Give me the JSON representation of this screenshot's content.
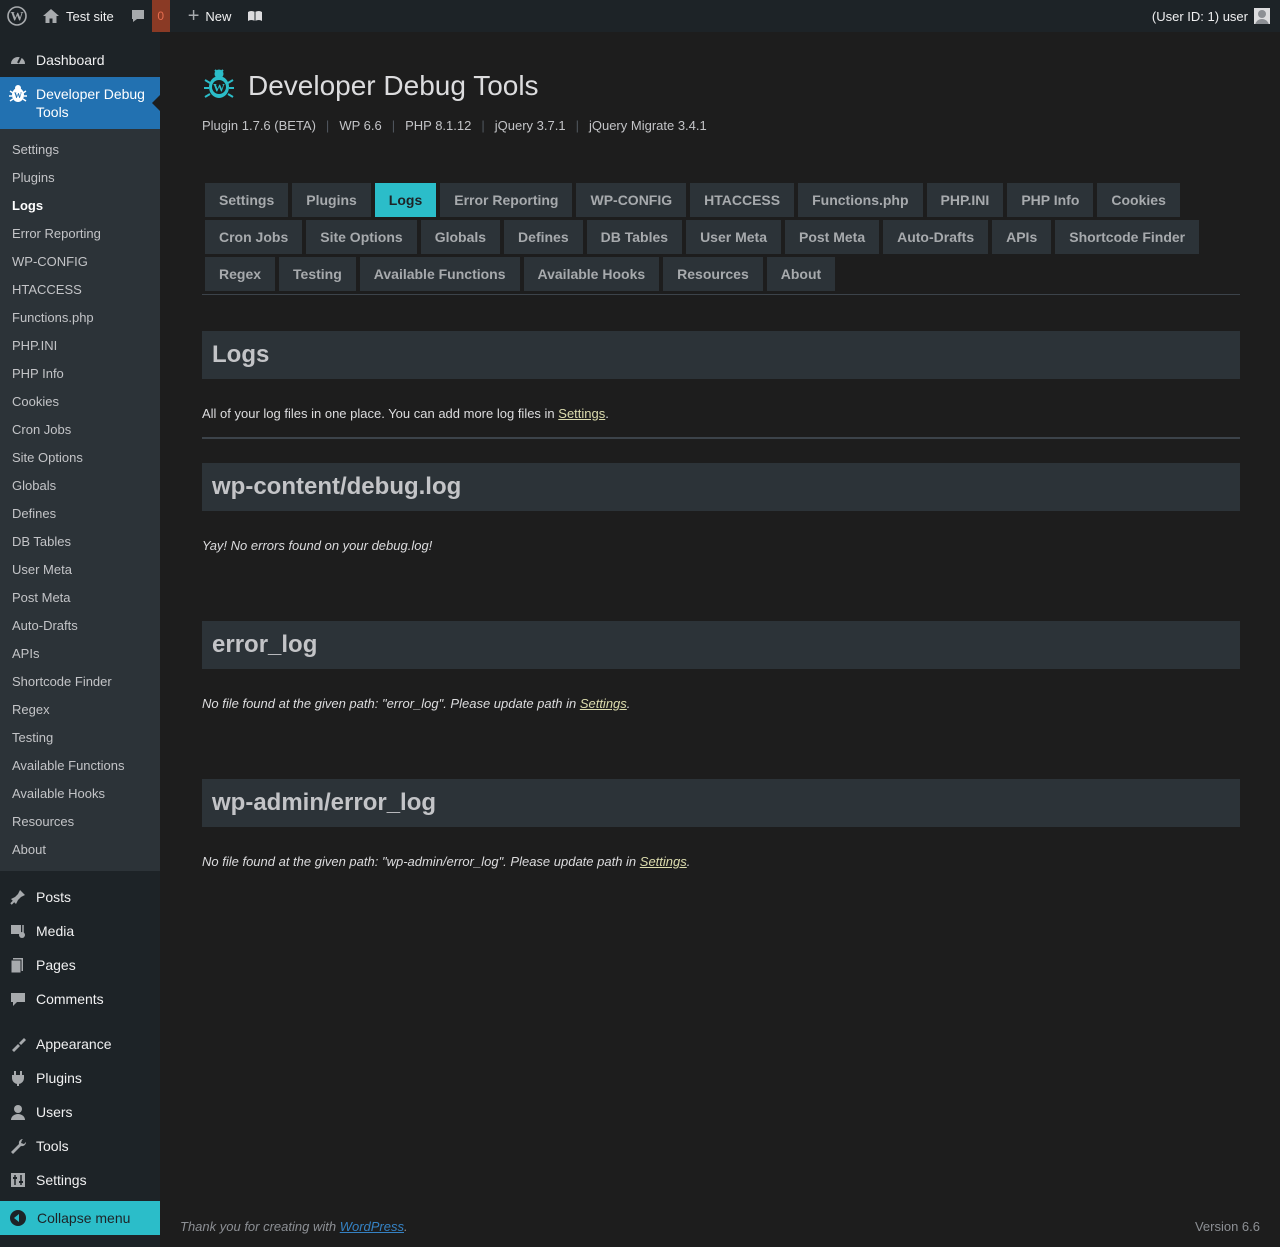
{
  "adminbar": {
    "site_name": "Test site",
    "comments_count": "0",
    "new_label": "New",
    "user_label": "(User ID: 1) user"
  },
  "sidebar": {
    "dashboard": "Dashboard",
    "current_menu": "Developer Debug Tools",
    "submenu": [
      "Settings",
      "Plugins",
      "Logs",
      "Error Reporting",
      "WP-CONFIG",
      "HTACCESS",
      "Functions.php",
      "PHP.INI",
      "PHP Info",
      "Cookies",
      "Cron Jobs",
      "Site Options",
      "Globals",
      "Defines",
      "DB Tables",
      "User Meta",
      "Post Meta",
      "Auto-Drafts",
      "APIs",
      "Shortcode Finder",
      "Regex",
      "Testing",
      "Available Functions",
      "Available Hooks",
      "Resources",
      "About"
    ],
    "active_sub": "Logs",
    "menu": [
      "Posts",
      "Media",
      "Pages",
      "Comments",
      "Appearance",
      "Plugins",
      "Users",
      "Tools",
      "Settings"
    ],
    "collapse": "Collapse menu"
  },
  "page": {
    "title": "Developer Debug Tools",
    "versions": [
      "Plugin 1.7.6 (BETA)",
      "WP 6.6",
      "PHP 8.1.12",
      "jQuery 3.7.1",
      "jQuery Migrate 3.4.1"
    ],
    "tabs": [
      "Settings",
      "Plugins",
      "Logs",
      "Error Reporting",
      "WP-CONFIG",
      "HTACCESS",
      "Functions.php",
      "PHP.INI",
      "PHP Info",
      "Cookies",
      "Cron Jobs",
      "Site Options",
      "Globals",
      "Defines",
      "DB Tables",
      "User Meta",
      "Post Meta",
      "Auto-Drafts",
      "APIs",
      "Shortcode Finder",
      "Regex",
      "Testing",
      "Available Functions",
      "Available Hooks",
      "Resources",
      "About"
    ],
    "active_tab": "Logs",
    "section_title": "Logs",
    "description_prefix": "All of your log files in one place. You can add more log files in ",
    "description_link": "Settings",
    "description_suffix": ".",
    "logs": [
      {
        "title": "wp-content/debug.log",
        "message": "Yay! No errors found on your debug.log!",
        "link": "",
        "suffix": ""
      },
      {
        "title": "error_log",
        "message": "No file found at the given path: \"error_log\". Please update path in ",
        "link": "Settings",
        "suffix": "."
      },
      {
        "title": "wp-admin/error_log",
        "message": "No file found at the given path: \"wp-admin/error_log\". Please update path in ",
        "link": "Settings",
        "suffix": "."
      }
    ]
  },
  "footer": {
    "thanks_prefix": "Thank you for creating with ",
    "thanks_link": "WordPress",
    "thanks_suffix": ".",
    "version": "Version 6.6"
  },
  "colors": {
    "accent": "#2bbdc9",
    "current_menu": "#2271b1",
    "link": "#dcdcae"
  }
}
